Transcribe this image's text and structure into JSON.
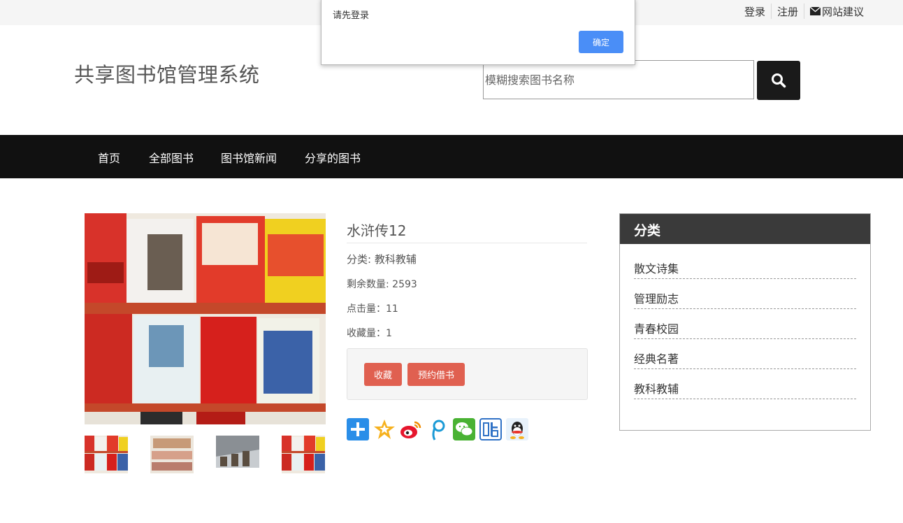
{
  "topbar": {
    "login": "登录",
    "register": "注册",
    "feedback": "网站建议",
    "feedback_icon": "envelope-icon"
  },
  "header": {
    "site_title": "共享图书馆管理系统",
    "search_placeholder": "模糊搜索图书名称",
    "search_icon": "magnifier-icon"
  },
  "nav": {
    "items": [
      "首页",
      "全部图书",
      "图书馆新闻",
      "分享的图书"
    ]
  },
  "dialog": {
    "message": "请先登录",
    "ok_label": "确定"
  },
  "book": {
    "title": "水浒传12",
    "category_line": "分类: 教科教辅",
    "remaining_line": "剩余数量: 2593",
    "clicks_line": "点击量：11",
    "favorites_line": "收藏量：1",
    "favorite_btn": "收藏",
    "reserve_btn": "预约借书"
  },
  "share": {
    "icons": [
      "share-plus-icon",
      "qzone-icon",
      "weibo-icon",
      "tencent-weibo-icon",
      "wechat-icon",
      "tieba-icon",
      "qq-icon"
    ]
  },
  "sidebar": {
    "heading": "分类",
    "categories": [
      "散文诗集",
      "管理励志",
      "青春校园",
      "经典名著",
      "教科教辅"
    ]
  },
  "colors": {
    "nav_bg": "#111111",
    "search_btn": "#1a1a1a",
    "accent_red": "#e06050",
    "dialog_ok": "#4a8ef7",
    "sidebar_head": "#3a3a3a"
  }
}
